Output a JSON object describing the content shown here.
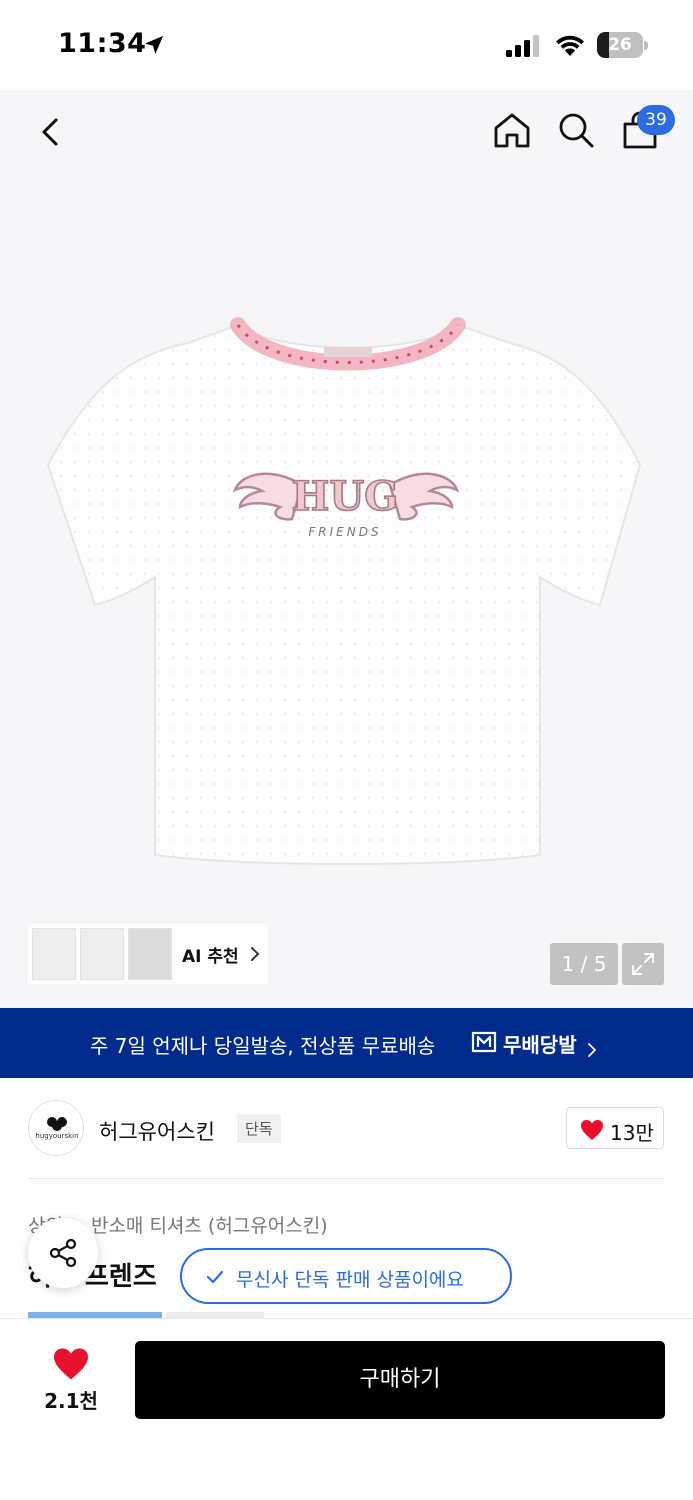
{
  "status_bar": {
    "time": "11:34",
    "battery_level": "26",
    "battery_fraction": 0.26,
    "icons": [
      "location-arrow-icon",
      "cellular-signal-icon",
      "wifi-icon",
      "battery-icon"
    ]
  },
  "nav": {
    "icons": [
      "back-chevron-icon",
      "home-icon",
      "search-icon",
      "shopping-bag-icon"
    ],
    "cart_count": "39"
  },
  "gallery": {
    "print_word": "HUG",
    "print_subword": "FRIENDS",
    "ai_recommend_label": "AI 추천",
    "page_counter": "1 / 5",
    "expand_icon": "expand-icon"
  },
  "promo": {
    "text": "주 7일 언제나 당일발송, 전상품 무료배송",
    "brand_label": "무배당발",
    "background": "#002b8c"
  },
  "brand": {
    "logo_text": "hugyourskin",
    "name": "허그유어스킨",
    "tag": "단독",
    "likes": "13만"
  },
  "product": {
    "breadcrumb": "상의 > 반소매 티셔츠 (허그유어스킨)",
    "title": "허그 프렌즈",
    "exclusive_badge": "무신사 단독 판매 상품이에요"
  },
  "bottom_bar": {
    "wish_count": "2.1천",
    "buy_label": "구매하기"
  },
  "colors": {
    "accent_blue": "#2d6be0",
    "heart_red": "#e8112d",
    "buy_black": "#000000"
  }
}
